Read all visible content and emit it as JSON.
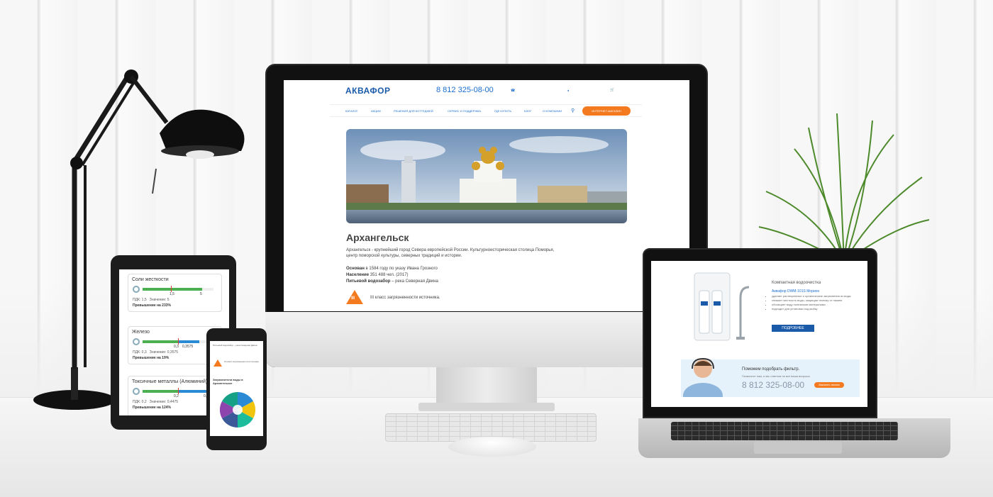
{
  "desktop_site": {
    "logo": "АКВАФОР",
    "phone": "8 812 325-08-00",
    "nav": [
      {
        "label": "Каталог"
      },
      {
        "label": "Акции"
      },
      {
        "label": "Решения для коттеджей"
      },
      {
        "label": "Сервис и поддержка"
      },
      {
        "label": "Где купить"
      },
      {
        "label": "Блог"
      },
      {
        "label": "О компании"
      }
    ],
    "shop_button": "Интернет-магазин",
    "city_title": "Архангельск",
    "intro": "Архангельск - крупнейший город Севера европейской России. Культурноисторическая столица Поморья, центр поморской культуры, северных традиций и истории.",
    "facts": [
      {
        "label": "Основан",
        "value": "в 1584 году по указу Ивана Грозного"
      },
      {
        "label": "Население",
        "value": "351 488 чел. (2017)"
      },
      {
        "label": "Питьевой водозабор",
        "value": "– река Северная Двина"
      }
    ],
    "pollution_badge": "III",
    "pollution_text": "III класс загрязненности источника."
  },
  "tablet": {
    "cards": [
      {
        "title": "Соли жесткости",
        "pdk": "ПДК: 1,5",
        "value": "Значение: 5",
        "exceed": "Превышение на 233%",
        "mark": "1,5",
        "val": "5",
        "pdk_num": 1.5,
        "val_num": 5
      },
      {
        "title": "Железо",
        "pdk": "ПДК: 0,3",
        "value": "Значение: 0,3575",
        "exceed": "Превышение на 19%",
        "mark": "0,3",
        "val": "0,3575",
        "pdk_num": 0.3,
        "val_num": 0.3575
      },
      {
        "title": "Токсичные металлы (Алюминий)",
        "pdk": "ПДК: 0,2",
        "value": "Значение: 0,4475",
        "exceed": "Превышение на 124%",
        "mark": "0,2",
        "val": "0,447",
        "pdk_num": 0.2,
        "val_num": 0.4475
      }
    ]
  },
  "mobile": {
    "source_text": "Питьевой водозабор – река Северная Двина",
    "pollution_text": "III класс загрязненности источника.",
    "chart_heading": "Загрязнители воды в Архангельске"
  },
  "laptop": {
    "product_title": "Компактная водоочистка",
    "product_name": "Аквафор DWM-101S Морион",
    "bullets": [
      "удаляет растворенные и органические загрязнения из воды",
      "снижает жесткость воды, защищая технику от накипи",
      "обогащает воду полезными минералами",
      "подходит для установки под мойку"
    ],
    "more_button": "Подробнее",
    "help_title": "Поможем подобрать фильтр.",
    "help_sub": "Позвоните нам, и мы ответим на все ваши вопросы",
    "help_phone": "8 812 325-08-00",
    "help_button": "Заказать звонок"
  }
}
